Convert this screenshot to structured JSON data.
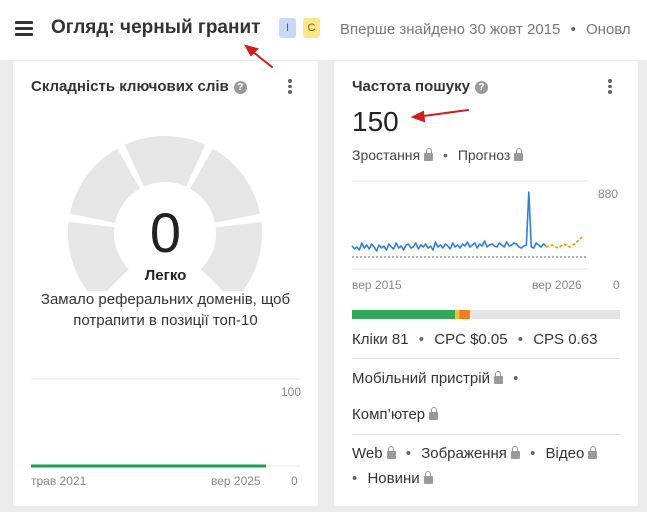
{
  "header": {
    "title": "Огляд: черный гранит",
    "badges": [
      "I",
      "C"
    ],
    "first_seen": "Вперше знайдено 30 жовт 2015",
    "updated": "Оновл"
  },
  "kd_card": {
    "title": "Складність ключових слів",
    "value": "0",
    "level": "Легко",
    "description_line1": "Замало реферальних доменів, щоб",
    "description_line2": "потрапити в позиції топ-10",
    "chart": {
      "y_max_label": "100",
      "y_min_label": "0",
      "x_start_label": "трав 2021",
      "x_end_label": "вер 2025",
      "line_color": "#1f9d55",
      "gauge_fill": 0
    }
  },
  "sv_card": {
    "title": "Частота пошуку",
    "value": "150",
    "growth_label": "Зростання",
    "forecast_label": "Прогноз",
    "chart": {
      "y_max_label": "880",
      "y_min_label": "0",
      "x_start_label": "вер 2015",
      "x_end_label": "вер 2026",
      "line_color": "#2f7fd6",
      "forecast_color": "#f39c12"
    },
    "intent_bar": [
      {
        "color": "#2fa85a",
        "fraction": 0.385
      },
      {
        "color": "#f2c02a",
        "fraction": 0.015
      },
      {
        "color": "#f47b20",
        "fraction": 0.04
      },
      {
        "color": "#e5e5e5",
        "fraction": 0.56
      }
    ],
    "clicks": "Кліки 81",
    "cpc": "CPC $0.05",
    "cps": "CPS 0.63",
    "mobile_label": "Мобільний пристрій",
    "desktop_label": "Комп’ютер",
    "web_label": "Web",
    "images_label": "Зображення",
    "video_label": "Відео",
    "news_label": "Новини"
  }
}
